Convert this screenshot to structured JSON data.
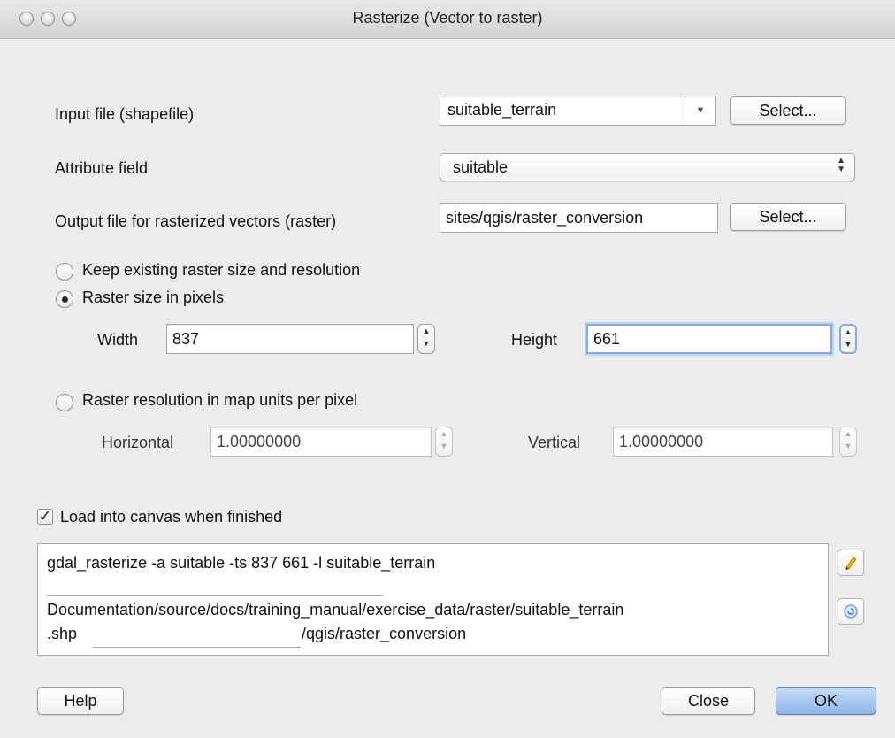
{
  "window": {
    "title": "Rasterize (Vector to raster)"
  },
  "input_file": {
    "label": "Input file (shapefile)",
    "value": "suitable_terrain",
    "select_label": "Select..."
  },
  "attribute_field": {
    "label": "Attribute field",
    "value": "suitable"
  },
  "output_file": {
    "label": "Output file for rasterized vectors (raster)",
    "value": "sites/qgis/raster_conversion",
    "select_label": "Select..."
  },
  "options": {
    "keep_existing_label": "Keep existing raster size and resolution",
    "raster_size_label": "Raster size in pixels",
    "selected": "Raster size in pixels",
    "width_label": "Width",
    "width_value": "837",
    "height_label": "Height",
    "height_value": "661",
    "resolution_label": "Raster resolution in map units per pixel",
    "horizontal_label": "Horizontal",
    "horizontal_value": "1.00000000",
    "vertical_label": "Vertical",
    "vertical_value": "1.00000000"
  },
  "load_canvas": {
    "label": "Load into canvas when finished",
    "checked": true
  },
  "command": {
    "line1": "gdal_rasterize -a suitable -ts 837 661 -l suitable_terrain",
    "line2": "Documentation/source/docs/training_manual/exercise_data/raster/suitable_terrain",
    "line3a": ".shp",
    "line3b": "/qgis/raster_conversion"
  },
  "buttons": {
    "help": "Help",
    "close": "Close",
    "ok": "OK"
  },
  "icons": {
    "edit": "pencil-icon",
    "reset": "reset-icon"
  }
}
